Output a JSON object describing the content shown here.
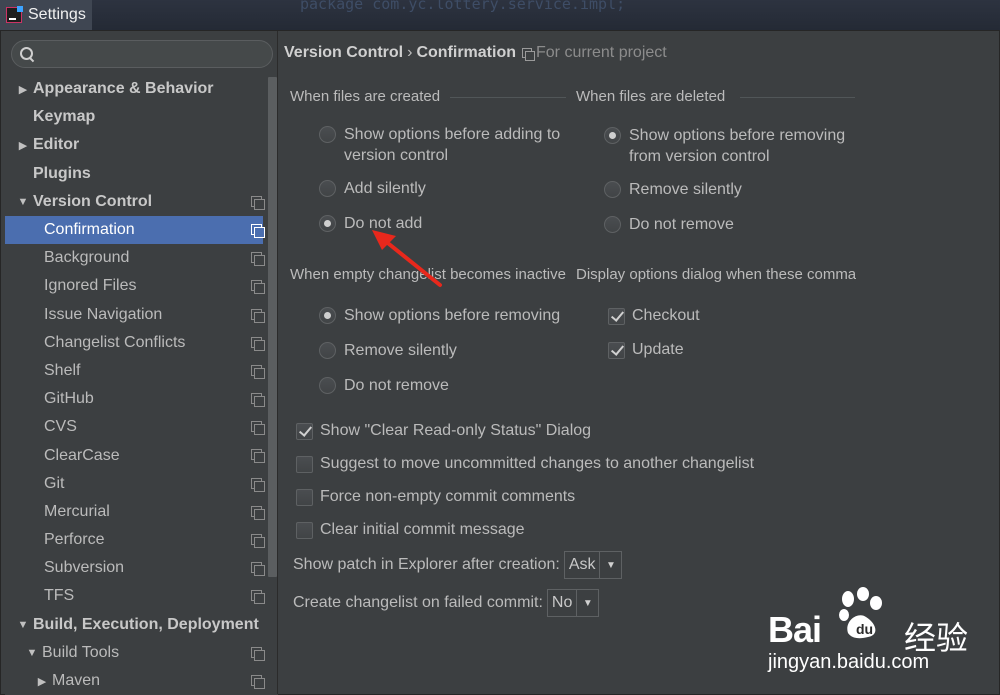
{
  "window": {
    "title": "Settings",
    "background_code": "package com.yc.lottery.service.impl;"
  },
  "search": {
    "placeholder": "",
    "value": ""
  },
  "tree": {
    "appearance": "Appearance & Behavior",
    "keymap": "Keymap",
    "editor": "Editor",
    "plugins": "Plugins",
    "version_control": "Version Control",
    "vc_children": {
      "confirmation": "Confirmation",
      "background": "Background",
      "ignored_files": "Ignored Files",
      "issue_navigation": "Issue Navigation",
      "changelist_conflicts": "Changelist Conflicts",
      "shelf": "Shelf",
      "github": "GitHub",
      "cvs": "CVS",
      "clearcase": "ClearCase",
      "git": "Git",
      "mercurial": "Mercurial",
      "perforce": "Perforce",
      "subversion": "Subversion",
      "tfs": "TFS"
    },
    "build": "Build, Execution, Deployment",
    "build_tools": "Build Tools",
    "maven": "Maven",
    "selected": "Confirmation"
  },
  "breadcrumb": {
    "parent": "Version Control",
    "separator": "›",
    "current": "Confirmation",
    "note": "For current project"
  },
  "files_created": {
    "title": "When files are created",
    "options": [
      "Show options before adding to version control",
      "Add silently",
      "Do not add"
    ],
    "selected": "Do not add"
  },
  "files_deleted": {
    "title": "When files are deleted",
    "options": [
      "Show options before removing from version control",
      "Remove silently",
      "Do not remove"
    ],
    "selected": "Show options before removing from version control"
  },
  "empty_changelist": {
    "title": "When empty changelist becomes inactive",
    "options": [
      "Show options before removing",
      "Remove silently",
      "Do not remove"
    ],
    "selected": "Show options before removing"
  },
  "display_options": {
    "title": "Display options dialog when these commands are invoked",
    "checkout": {
      "label": "Checkout",
      "checked": true
    },
    "update": {
      "label": "Update",
      "checked": true
    }
  },
  "checkboxes": {
    "clear_readonly": {
      "label": "Show \"Clear Read-only Status\" Dialog",
      "checked": true
    },
    "suggest_move": {
      "label": "Suggest to move uncommitted changes to another changelist",
      "checked": false
    },
    "force_comments": {
      "label": "Force non-empty commit comments",
      "checked": false
    },
    "clear_initial": {
      "label": "Clear initial commit message",
      "checked": false
    }
  },
  "patch": {
    "label": "Show patch in Explorer after creation:",
    "value": "Ask"
  },
  "failed_commit": {
    "label": "Create changelist on failed commit:",
    "value": "No"
  },
  "watermark": {
    "brand": "Bai",
    "brand_cn": "经验",
    "url": "jingyan.baidu.com"
  },
  "colors": {
    "selection": "#4b6eaf",
    "panel": "#3c3f41",
    "annotation_arrow": "#e8281c"
  }
}
